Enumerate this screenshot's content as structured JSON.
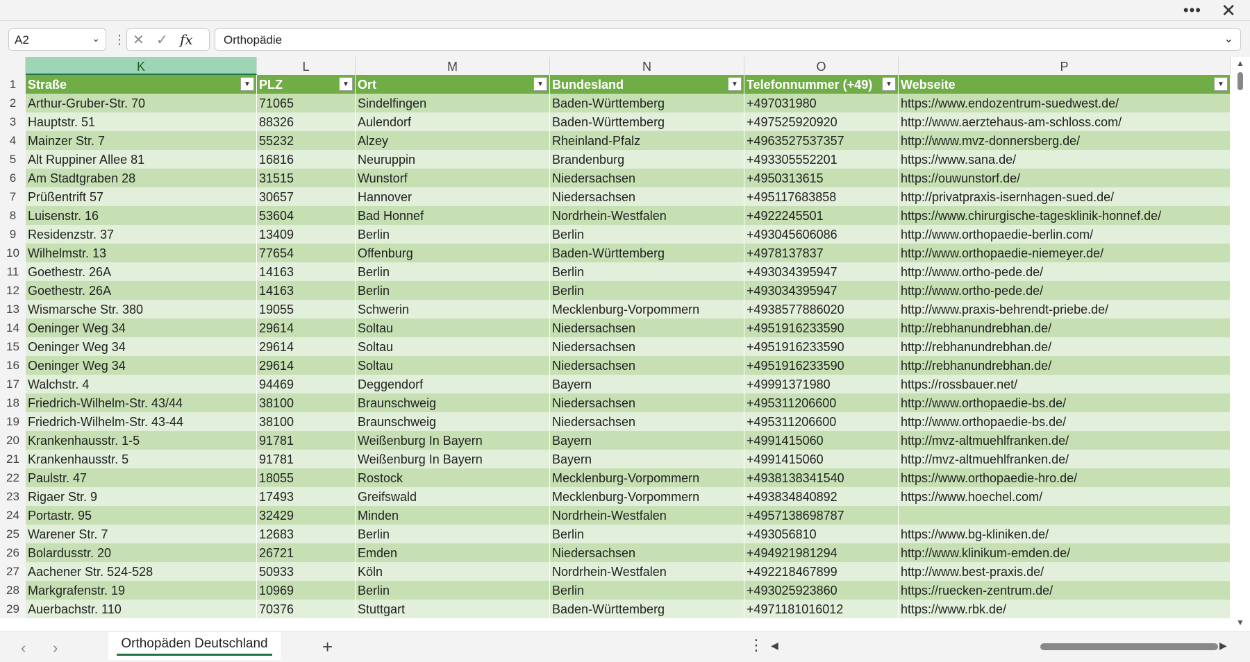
{
  "window": {
    "more_icon": "more-icon",
    "close_icon": "close-icon"
  },
  "formula_bar": {
    "name_box": "A2",
    "formula": "Orthopädie",
    "cancel_glyph": "✕",
    "enter_glyph": "✓",
    "fx_label": "fx"
  },
  "columns": [
    "K",
    "L",
    "M",
    "N",
    "O",
    "P"
  ],
  "selected_column": "K",
  "header_row": {
    "row_number": "1",
    "cells": [
      "Straße",
      "PLZ",
      "Ort",
      "Bundesland",
      "Telefonnummer (+49)",
      "Webseite"
    ]
  },
  "rows": [
    {
      "n": "2",
      "cells": [
        "Arthur-Gruber-Str. 70",
        "71065",
        "Sindelfingen",
        "Baden-Württemberg",
        "+497031980",
        "https://www.endozentrum-suedwest.de/"
      ]
    },
    {
      "n": "3",
      "cells": [
        "Hauptstr. 51",
        "88326",
        "Aulendorf",
        "Baden-Württemberg",
        "+497525920920",
        "http://www.aerztehaus-am-schloss.com/"
      ]
    },
    {
      "n": "4",
      "cells": [
        "Mainzer Str. 7",
        "55232",
        "Alzey",
        "Rheinland-Pfalz",
        "+4963527537357",
        "http://www.mvz-donnersberg.de/"
      ]
    },
    {
      "n": "5",
      "cells": [
        "Alt Ruppiner Allee 81",
        "16816",
        "Neuruppin",
        "Brandenburg",
        "+493305552201",
        "https://www.sana.de/"
      ]
    },
    {
      "n": "6",
      "cells": [
        "Am Stadtgraben 28",
        "31515",
        "Wunstorf",
        "Niedersachsen",
        "+4950313615",
        "https://ouwunstorf.de/"
      ]
    },
    {
      "n": "7",
      "cells": [
        "Prüßentrift 57",
        "30657",
        "Hannover",
        "Niedersachsen",
        "+495117683858",
        "http://privatpraxis-isernhagen-sued.de/"
      ]
    },
    {
      "n": "8",
      "cells": [
        "Luisenstr. 16",
        "53604",
        "Bad Honnef",
        "Nordrhein-Westfalen",
        "+4922245501",
        "https://www.chirurgische-tagesklinik-honnef.de/"
      ]
    },
    {
      "n": "9",
      "cells": [
        "Residenzstr. 37",
        "13409",
        "Berlin",
        "Berlin",
        "+493045606086",
        "http://www.orthopaedie-berlin.com/"
      ]
    },
    {
      "n": "10",
      "cells": [
        "Wilhelmstr. 13",
        "77654",
        "Offenburg",
        "Baden-Württemberg",
        "+4978137837",
        "http://www.orthopaedie-niemeyer.de/"
      ]
    },
    {
      "n": "11",
      "cells": [
        "Goethestr. 26A",
        "14163",
        "Berlin",
        "Berlin",
        "+493034395947",
        "http://www.ortho-pede.de/"
      ]
    },
    {
      "n": "12",
      "cells": [
        "Goethestr. 26A",
        "14163",
        "Berlin",
        "Berlin",
        "+493034395947",
        "http://www.ortho-pede.de/"
      ]
    },
    {
      "n": "13",
      "cells": [
        "Wismarsche Str. 380",
        "19055",
        "Schwerin",
        "Mecklenburg-Vorpommern",
        "+4938577886020",
        "http://www.praxis-behrendt-priebe.de/"
      ]
    },
    {
      "n": "14",
      "cells": [
        "Oeninger Weg 34",
        "29614",
        "Soltau",
        "Niedersachsen",
        "+4951916233590",
        "http://rebhanundrebhan.de/"
      ]
    },
    {
      "n": "15",
      "cells": [
        "Oeninger Weg 34",
        "29614",
        "Soltau",
        "Niedersachsen",
        "+4951916233590",
        "http://rebhanundrebhan.de/"
      ]
    },
    {
      "n": "16",
      "cells": [
        "Oeninger Weg 34",
        "29614",
        "Soltau",
        "Niedersachsen",
        "+4951916233590",
        "http://rebhanundrebhan.de/"
      ]
    },
    {
      "n": "17",
      "cells": [
        "Walchstr. 4",
        "94469",
        "Deggendorf",
        "Bayern",
        "+49991371980",
        "https://rossbauer.net/"
      ]
    },
    {
      "n": "18",
      "cells": [
        "Friedrich-Wilhelm-Str. 43/44",
        "38100",
        "Braunschweig",
        "Niedersachsen",
        "+495311206600",
        "http://www.orthopaedie-bs.de/"
      ]
    },
    {
      "n": "19",
      "cells": [
        "Friedrich-Wilhelm-Str. 43-44",
        "38100",
        "Braunschweig",
        "Niedersachsen",
        "+495311206600",
        "http://www.orthopaedie-bs.de/"
      ]
    },
    {
      "n": "20",
      "cells": [
        "Krankenhausstr. 1-5",
        "91781",
        "Weißenburg In Bayern",
        "Bayern",
        "+4991415060",
        "http://mvz-altmuehlfranken.de/"
      ]
    },
    {
      "n": "21",
      "cells": [
        "Krankenhausstr. 5",
        "91781",
        "Weißenburg In Bayern",
        "Bayern",
        "+4991415060",
        "http://mvz-altmuehlfranken.de/"
      ]
    },
    {
      "n": "22",
      "cells": [
        "Paulstr. 47",
        "18055",
        "Rostock",
        "Mecklenburg-Vorpommern",
        "+4938138341540",
        "https://www.orthopaedie-hro.de/"
      ]
    },
    {
      "n": "23",
      "cells": [
        "Rigaer Str. 9",
        "17493",
        "Greifswald",
        "Mecklenburg-Vorpommern",
        "+493834840892",
        "https://www.hoechel.com/"
      ]
    },
    {
      "n": "24",
      "cells": [
        "Portastr. 95",
        "32429",
        "Minden",
        "Nordrhein-Westfalen",
        "+4957138698787",
        ""
      ]
    },
    {
      "n": "25",
      "cells": [
        "Warener Str. 7",
        "12683",
        "Berlin",
        "Berlin",
        "+493056810",
        "https://www.bg-kliniken.de/"
      ]
    },
    {
      "n": "26",
      "cells": [
        "Bolardusstr. 20",
        "26721",
        "Emden",
        "Niedersachsen",
        "+494921981294",
        "http://www.klinikum-emden.de/"
      ]
    },
    {
      "n": "27",
      "cells": [
        "Aachener Str. 524-528",
        "50933",
        "Köln",
        "Nordrhein-Westfalen",
        "+492218467899",
        "http://www.best-praxis.de/"
      ]
    },
    {
      "n": "28",
      "cells": [
        "Markgrafenstr. 19",
        "10969",
        "Berlin",
        "Berlin",
        "+493025923860",
        "https://ruecken-zentrum.de/"
      ]
    },
    {
      "n": "29",
      "cells": [
        "Auerbachstr. 110",
        "70376",
        "Stuttgart",
        "Baden-Württemberg",
        "+4971181016012",
        "https://www.rbk.de/"
      ]
    }
  ],
  "sheet_tab": "Orthopäden Deutschland",
  "colors": {
    "header_green": "#70ad47",
    "band_dark": "#c6e0b4",
    "band_light": "#e2efda",
    "accent": "#217346"
  }
}
